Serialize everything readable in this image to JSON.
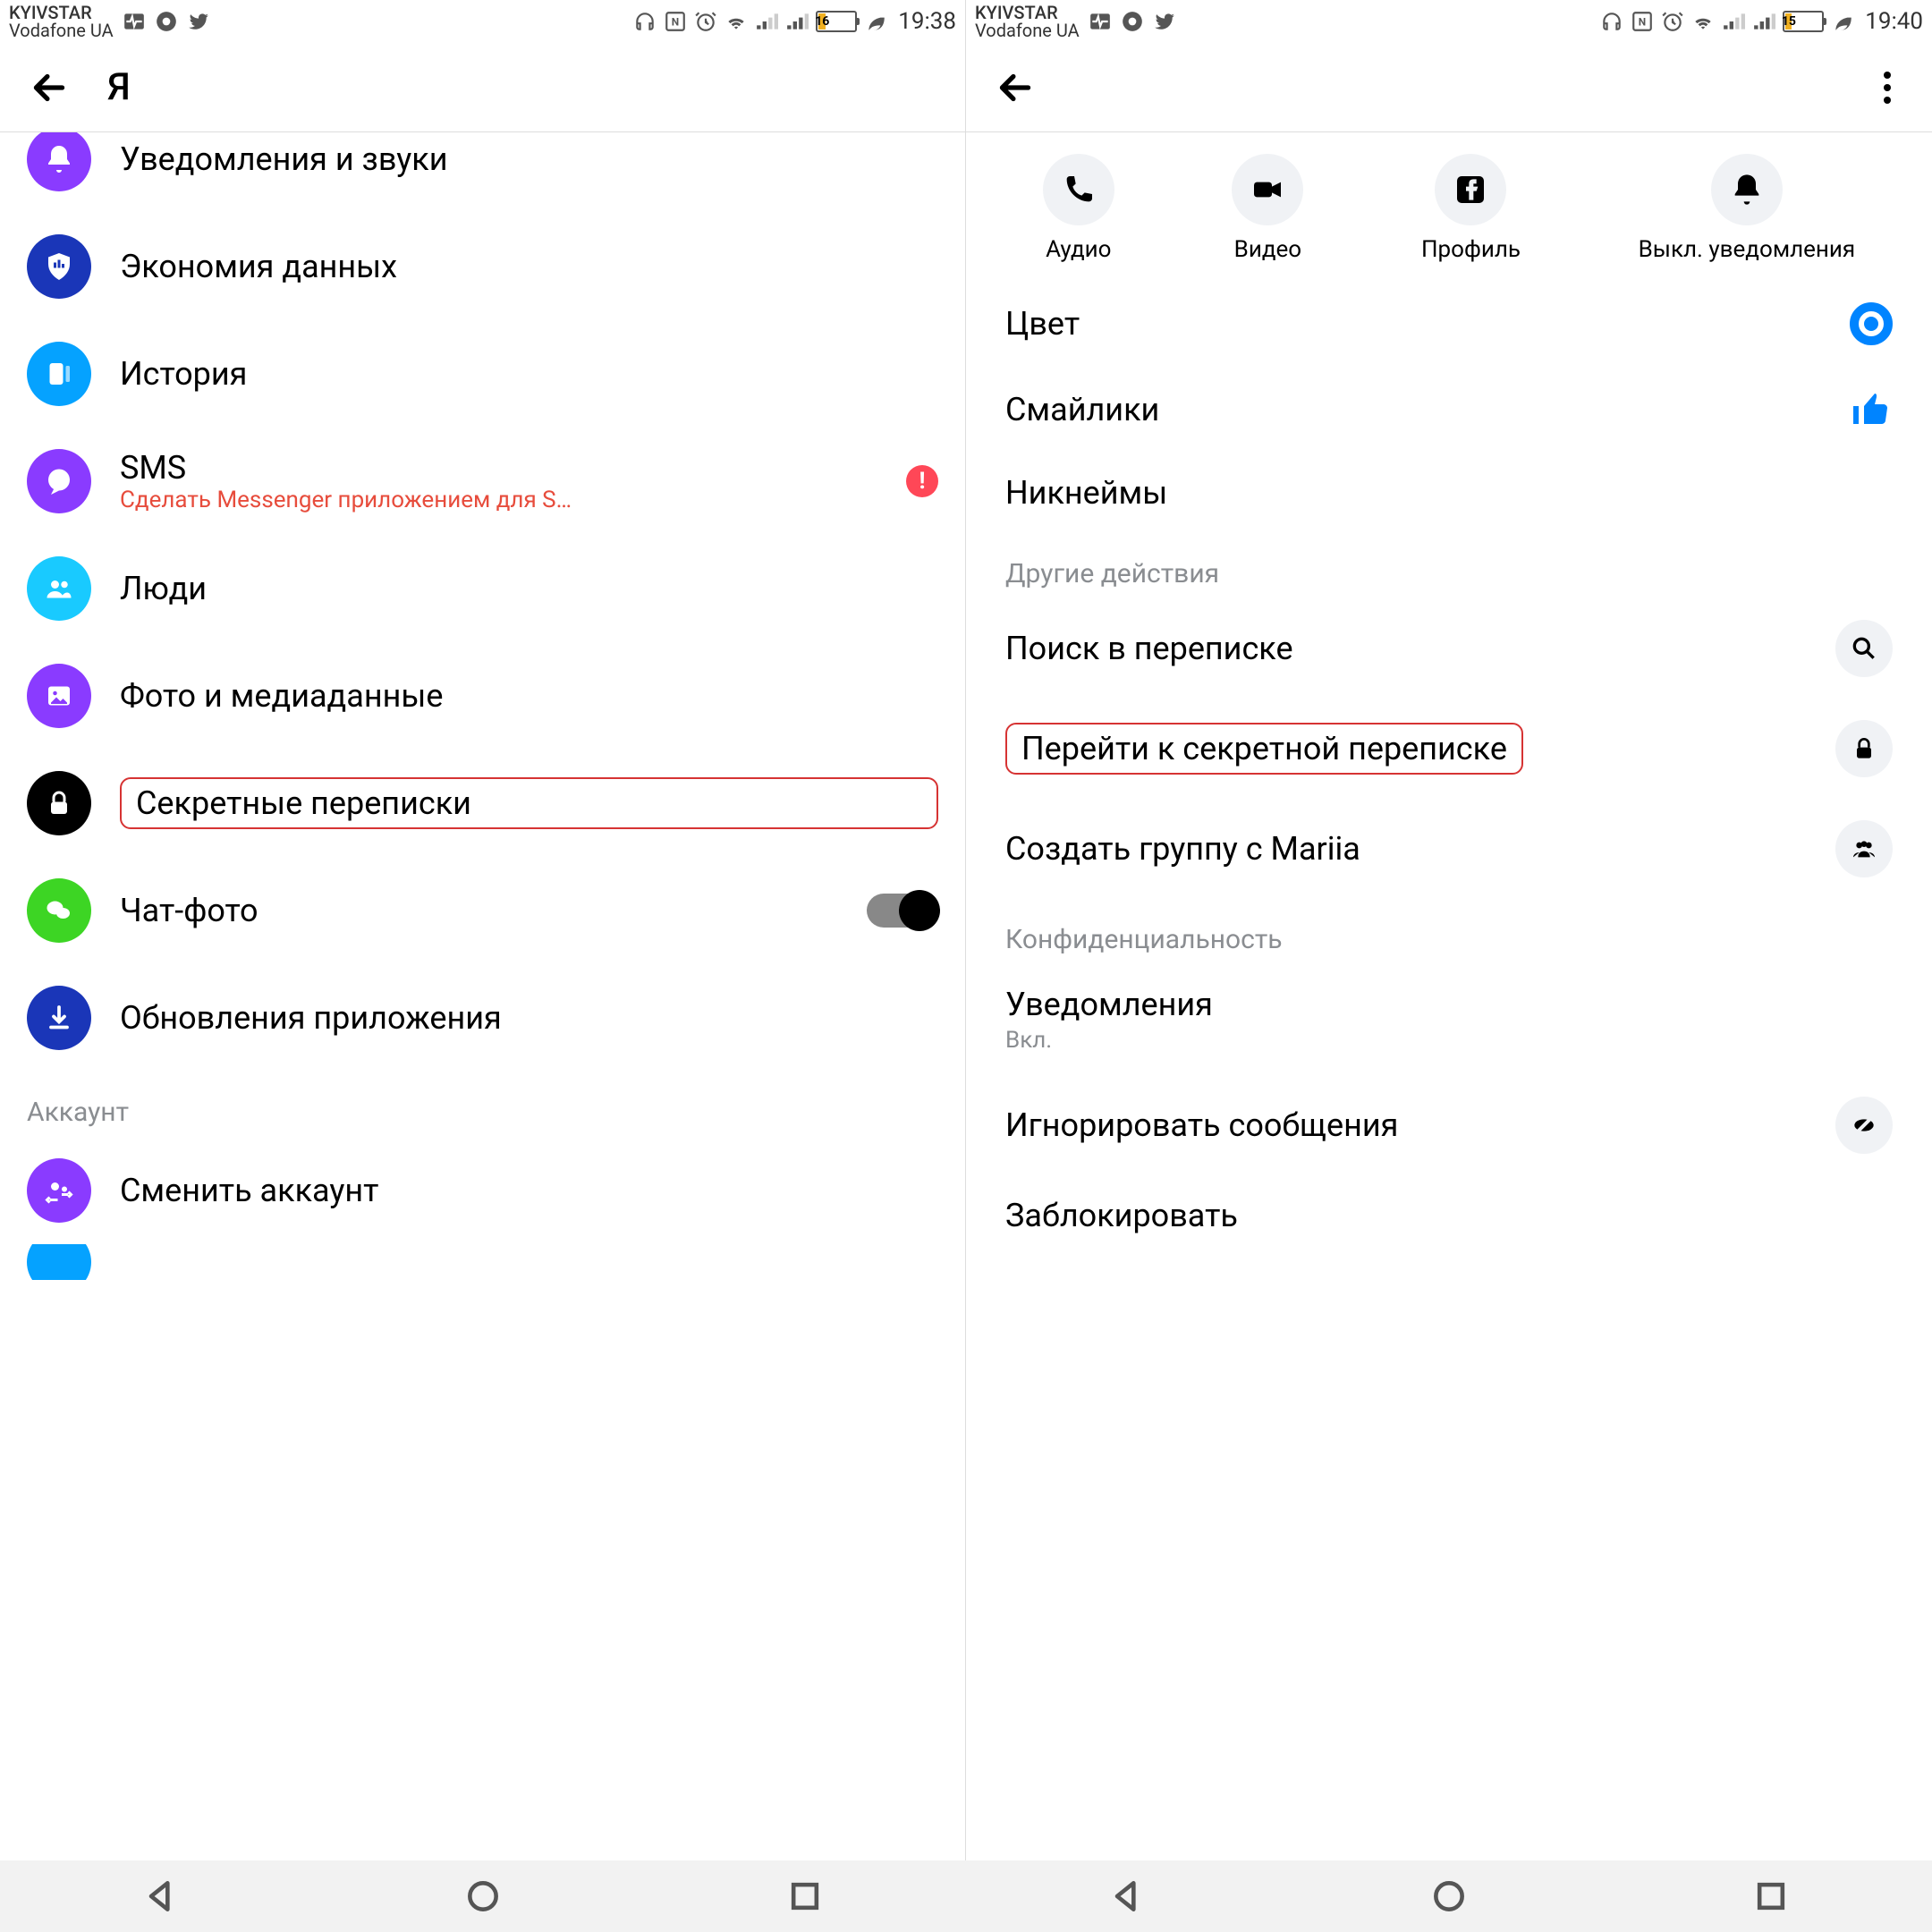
{
  "left": {
    "status": {
      "carrier1": "KYIVSTAR",
      "carrier2": "Vodafone UA",
      "battery_pct": "16",
      "time": "19:38"
    },
    "header": {
      "title": "Я"
    },
    "items": {
      "notifications": "Уведомления и звуки",
      "data_saver": "Экономия данных",
      "story": "История",
      "sms": "SMS",
      "sms_sub": "Сделать Messenger приложением для S…",
      "people": "Люди",
      "photos": "Фото и медиаданные",
      "secret": "Секретные переписки",
      "chat_photo": "Чат-фото",
      "updates": "Обновления приложения",
      "account_section": "Аккаунт",
      "switch_account": "Сменить аккаунт"
    }
  },
  "right": {
    "status": {
      "carrier1": "KYIVSTAR",
      "carrier2": "Vodafone UA",
      "battery_pct": "15",
      "time": "19:40"
    },
    "actions": {
      "audio": "Аудио",
      "video": "Видео",
      "profile": "Профиль",
      "mute": "Выкл. уведомления"
    },
    "rows": {
      "color": "Цвет",
      "emoji": "Смайлики",
      "nicknames": "Никнеймы",
      "other_section": "Другие действия",
      "search": "Поиск в переписке",
      "secret": "Перейти к секретной переписке",
      "group": "Создать группу с Mariia",
      "privacy_section": "Конфиденциальность",
      "notifications": "Уведомления",
      "notifications_sub": "Вкл.",
      "ignore": "Игнорировать сообщения",
      "block": "Заблокировать"
    }
  }
}
